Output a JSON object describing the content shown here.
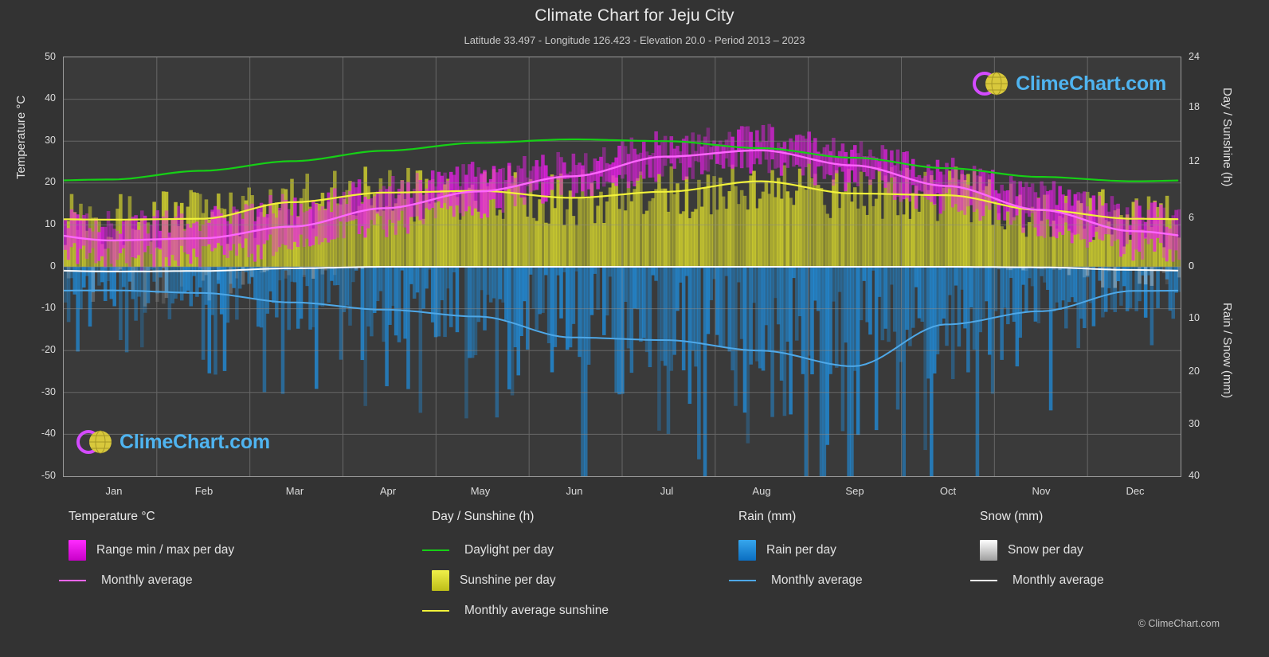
{
  "title": "Climate Chart for Jeju City",
  "subtitle": "Latitude 33.497 - Longitude 126.423 - Elevation 20.0 - Period 2013 – 2023",
  "copyright": "© ClimeChart.com",
  "watermark": {
    "brand_prefix": "Clime",
    "brand_suffix": "Chart.com"
  },
  "axes": {
    "left_title": "Temperature °C",
    "right_title_top": "Day / Sunshine (h)",
    "right_title_bottom": "Rain / Snow (mm)",
    "left_ticks": [
      "50",
      "40",
      "30",
      "20",
      "10",
      "0",
      "-10",
      "-20",
      "-30",
      "-40",
      "-50"
    ],
    "right_ticks_top": [
      "24",
      "18",
      "12",
      "6",
      "0"
    ],
    "right_ticks_bottom": [
      "0",
      "10",
      "20",
      "30",
      "40"
    ],
    "x_ticks": [
      "Jan",
      "Feb",
      "Mar",
      "Apr",
      "May",
      "Jun",
      "Jul",
      "Aug",
      "Sep",
      "Oct",
      "Nov",
      "Dec"
    ]
  },
  "legend": {
    "columns": [
      {
        "heading": "Temperature °C",
        "items": [
          {
            "label": "Range min / max per day",
            "type": "swatch",
            "color": "#e81ee8"
          },
          {
            "label": "Monthly average",
            "type": "line",
            "color": "#ff66ff"
          }
        ]
      },
      {
        "heading": "Day / Sunshine (h)",
        "items": [
          {
            "label": "Daylight per day",
            "type": "line",
            "color": "#16d016"
          },
          {
            "label": "Sunshine per day",
            "type": "swatch",
            "color": "#e3e32a"
          },
          {
            "label": "Monthly average sunshine",
            "type": "line",
            "color": "#f2f23a"
          }
        ]
      },
      {
        "heading": "Rain (mm)",
        "items": [
          {
            "label": "Rain per day",
            "type": "swatch",
            "color": "#1f8fe0"
          },
          {
            "label": "Monthly average",
            "type": "line",
            "color": "#4ea8e8"
          }
        ]
      },
      {
        "heading": "Snow (mm)",
        "items": [
          {
            "label": "Snow per day",
            "type": "swatch",
            "color": "#e6e6e6"
          },
          {
            "label": "Monthly average",
            "type": "line",
            "color": "#ffffff"
          }
        ]
      }
    ]
  },
  "chart_data": {
    "type": "line",
    "title": "Climate Chart for Jeju City",
    "subtitle": "Latitude 33.497 - Longitude 126.423 - Elevation 20.0 - Period 2013 – 2023",
    "location": "Jeju City",
    "latitude": 33.497,
    "longitude": 126.423,
    "elevation_m": 20.0,
    "period": "2013 – 2023",
    "xlabel": "",
    "ylabel": "Temperature °C",
    "ylabel_right_top": "Day / Sunshine (h)",
    "ylabel_right_bottom": "Rain / Snow (mm)",
    "ylim": [
      -50,
      50
    ],
    "ylim_right_top": [
      0,
      24
    ],
    "ylim_right_bottom": [
      0,
      40
    ],
    "grid": true,
    "legend_position": "below",
    "categories": [
      "Jan",
      "Feb",
      "Mar",
      "Apr",
      "May",
      "Jun",
      "Jul",
      "Aug",
      "Sep",
      "Oct",
      "Nov",
      "Dec"
    ],
    "series": [
      {
        "name": "Monthly average temperature (°C)",
        "color": "#ff66ff",
        "axis": "left",
        "values": [
          6.3,
          6.8,
          9.6,
          14.0,
          18.0,
          21.6,
          26.3,
          27.8,
          24.2,
          19.3,
          13.6,
          8.5
        ]
      },
      {
        "name": "Daylight per day (h)",
        "color": "#16d016",
        "axis": "right-top",
        "values": [
          10.0,
          11.0,
          12.1,
          13.3,
          14.2,
          14.6,
          14.4,
          13.6,
          12.5,
          11.3,
          10.3,
          9.8
        ]
      },
      {
        "name": "Monthly average sunshine (h)",
        "color": "#f2f23a",
        "axis": "right-top",
        "values": [
          5.4,
          5.5,
          7.4,
          8.5,
          8.7,
          7.9,
          8.6,
          9.8,
          8.4,
          8.2,
          6.5,
          5.5
        ]
      },
      {
        "name": "Monthly average rain (mm)",
        "color": "#4ea8e8",
        "axis": "right-bottom",
        "values": [
          4.5,
          5.0,
          6.8,
          8.2,
          9.5,
          13.5,
          14.0,
          16.0,
          19.0,
          11.0,
          8.5,
          4.6
        ]
      },
      {
        "name": "Monthly average snow (mm)",
        "color": "#ffffff",
        "axis": "right-bottom",
        "values": [
          0.9,
          0.8,
          0.3,
          0.0,
          0.0,
          0.0,
          0.0,
          0.0,
          0.0,
          0.0,
          0.1,
          0.6
        ]
      },
      {
        "name": "Daily temperature range min / max (°C)",
        "color": "#e81ee8",
        "axis": "left",
        "min_values": [
          2.0,
          2.5,
          5.5,
          10.0,
          14.5,
          19.0,
          23.5,
          25.0,
          21.0,
          15.5,
          10.0,
          4.5
        ],
        "max_values": [
          10.5,
          11.5,
          14.5,
          19.0,
          22.5,
          25.0,
          29.5,
          31.0,
          27.5,
          23.0,
          18.0,
          13.0
        ]
      }
    ]
  }
}
